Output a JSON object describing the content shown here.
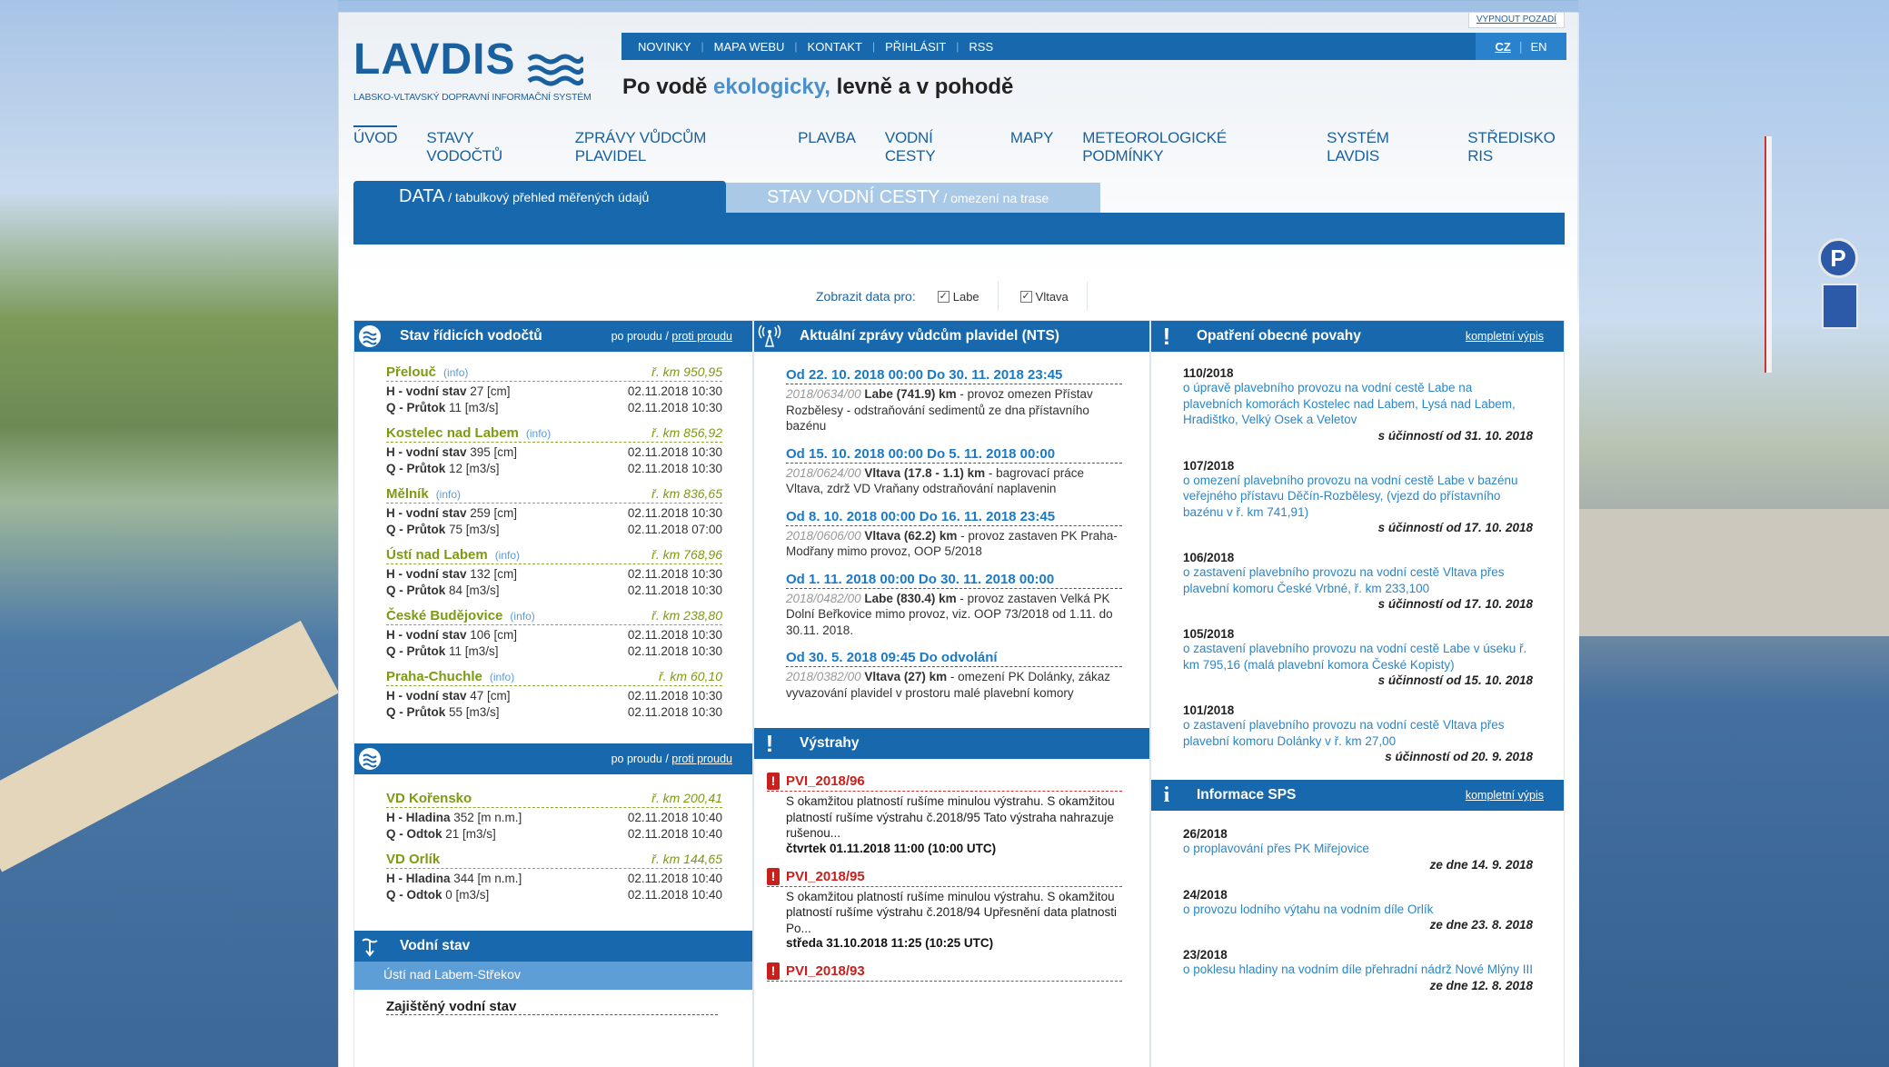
{
  "header": {
    "bg_toggle": "VYPNOUT POZADÍ",
    "logo_name": "LAVDIS",
    "logo_sub": "LABSKO-VLTAVSKÝ DOPRAVNÍ INFORMAČNÍ SYSTÉM",
    "topnav": [
      "NOVINKY",
      "MAPA WEBU",
      "KONTAKT",
      "PŘIHLÁSIT",
      "RSS"
    ],
    "lang_cz": "CZ",
    "lang_en": "EN",
    "slogan_a": "Po vodě ",
    "slogan_b": "ekologicky,",
    "slogan_c": " levně a v pohodě"
  },
  "mainnav": [
    "ÚVOD",
    "STAVY VODOČTŮ",
    "ZPRÁVY VŮDCŮM PLAVIDEL",
    "PLAVBA",
    "VODNÍ CESTY",
    "MAPY",
    "METEOROLOGICKÉ PODMÍNKY",
    "SYSTÉM LAVDIS",
    "STŘEDISKO RIS"
  ],
  "tabs": {
    "t1": "DATA",
    "t1_sub": " / tabulkový přehled měřených údajů",
    "t2": "STAV VODNÍ CESTY",
    "t2_sub": " / omezení na trase"
  },
  "filter": {
    "label": "Zobrazit data pro:",
    "opt1": "Labe",
    "opt2": "Vltava"
  },
  "col1": {
    "title": "Stav řídicích vodočtů",
    "dir_a": "po proudu / ",
    "dir_b": "proti proudu",
    "gauges": [
      {
        "name": "Přelouč",
        "info": "(info)",
        "km": "ř. km 950,95",
        "h_label": "H - vodní stav",
        "h_val": " 27 [cm]",
        "h_time": "02.11.2018 10:30",
        "q_label": "Q - Průtok",
        "q_val": " 11 [m3/s]",
        "q_time": "02.11.2018 10:30"
      },
      {
        "name": "Kostelec nad Labem",
        "info": "(info)",
        "km": "ř. km 856,92",
        "h_label": "H - vodní stav",
        "h_val": " 395 [cm]",
        "h_time": "02.11.2018 10:30",
        "q_label": "Q - Průtok",
        "q_val": " 12 [m3/s]",
        "q_time": "02.11.2018 10:30"
      },
      {
        "name": "Mělník",
        "info": "(info)",
        "km": "ř. km 836,65",
        "h_label": "H - vodní stav",
        "h_val": " 259 [cm]",
        "h_time": "02.11.2018 10:30",
        "q_label": "Q - Průtok",
        "q_val": " 75 [m3/s]",
        "q_time": "02.11.2018 07:00"
      },
      {
        "name": "Ústí nad Labem",
        "info": "(info)",
        "km": "ř. km 768,96",
        "h_label": "H - vodní stav",
        "h_val": " 132 [cm]",
        "h_time": "02.11.2018 10:30",
        "q_label": "Q - Průtok",
        "q_val": " 84 [m3/s]",
        "q_time": "02.11.2018 10:30"
      },
      {
        "name": "České Budějovice",
        "info": "(info)",
        "km": "ř. km 238,80",
        "h_label": "H - vodní stav",
        "h_val": " 106 [cm]",
        "h_time": "02.11.2018 10:30",
        "q_label": "Q - Průtok",
        "q_val": " 11 [m3/s]",
        "q_time": "02.11.2018 10:30"
      },
      {
        "name": "Praha-Chuchle",
        "info": "(info)",
        "km": "ř. km 60,10",
        "h_label": "H - vodní stav",
        "h_val": " 47 [cm]",
        "h_time": "02.11.2018 10:30",
        "q_label": "Q - Průtok",
        "q_val": " 55 [m3/s]",
        "q_time": "02.11.2018 10:30"
      }
    ],
    "dir2_a": "po proudu / ",
    "dir2_b": "proti proudu",
    "dams": [
      {
        "name": "VD Kořensko",
        "km": "ř. km 200,41",
        "h_label": "H - Hladina",
        "h_val": " 352 [m n.m.]",
        "h_time": "02.11.2018 10:40",
        "q_label": "Q - Odtok",
        "q_val": " 21 [m3/s]",
        "q_time": "02.11.2018 10:40"
      },
      {
        "name": "VD Orlík",
        "km": "ř. km 144,65",
        "h_label": "H - Hladina",
        "h_val": " 344 [m n.m.]",
        "h_time": "02.11.2018 10:40",
        "q_label": "Q - Odtok",
        "q_val": " 0 [m3/s]",
        "q_time": "02.11.2018 10:40"
      }
    ],
    "vodni_stav": "Vodní stav",
    "station": "Ústí nad Labem-Střekov",
    "zaj": "Zajištěný vodní stav"
  },
  "col2": {
    "title": "Aktuální zprávy vůdcům plavidel (NTS)",
    "items": [
      {
        "date": "Od 22. 10. 2018 00:00 Do 30. 11. 2018 23:45",
        "ref": "2018/0634/00",
        "loc": " Labe (741.9) km",
        "rest": " - provoz omezen Přístav Rozbělesy - odstraňování sedimentů ze dna přístavního bazénu"
      },
      {
        "date": "Od 15. 10. 2018 00:00 Do 5. 11. 2018 00:00",
        "ref": "2018/0624/00",
        "loc": " Vltava (17.8 - 1.1) km",
        "rest": " - bagrovací práce Vltava, zdrž VD Vraňany odstraňování naplavenin"
      },
      {
        "date": "Od 8. 10. 2018 00:00 Do 16. 11. 2018 23:45",
        "ref": "2018/0606/00",
        "loc": " Vltava (62.2) km",
        "rest": " - provoz zastaven PK Praha-Modřany mimo provoz, OOP 5/2018"
      },
      {
        "date": "Od 1. 11. 2018 00:00 Do 30. 11. 2018 00:00",
        "ref": "2018/0482/00",
        "loc": " Labe (830.4) km",
        "rest": " - provoz zastaven Velká PK Dolní Beřkovice mimo provoz, viz. OOP 73/2018 od 1.11. do 30.11. 2018."
      },
      {
        "date": "Od 30. 5. 2018 09:45 Do odvolání",
        "ref": "2018/0382/00",
        "loc": " Vltava (27) km",
        "rest": " - omezení PK Dolánky, zákaz vyvazování plavidel v prostoru malé plavební komory"
      }
    ],
    "warn_title": "Výstrahy",
    "warnings": [
      {
        "id": "PVI_2018/96",
        "text": "S okamžitou platností rušíme minulou výstrahu. S okamžitou platností rušíme výstrahu č.2018/95 Tato výstraha nahrazuje rušenou...",
        "date": "čtvrtek 01.11.2018 11:00 (10:00 UTC)"
      },
      {
        "id": "PVI_2018/95",
        "text": "S okamžitou platností rušíme minulou výstrahu. S okamžitou platností rušíme výstrahu č.2018/94 Upřesnění data platnosti Po...",
        "date": "středa 31.10.2018 11:25 (10:25 UTC)"
      },
      {
        "id": "PVI_2018/93",
        "text": "",
        "date": ""
      }
    ]
  },
  "col3": {
    "title": "Opatření obecné povahy",
    "link": "kompletní výpis",
    "items": [
      {
        "num": "110/2018",
        "text": "o úpravě plavebního provozu na vodní cestě Labe na plavebních komorách Kostelec nad Labem, Lysá nad Labem, Hradištko, Velký Osek a Veletov",
        "eff": "s účinností od 31. 10. 2018"
      },
      {
        "num": "107/2018",
        "text": "o omezení plavebního provozu na vodní cestě Labe v bazénu veřejného přístavu Děčín-Rozbělesy, (vjezd do přístavního bazénu v ř. km 741,91)",
        "eff": "s účinností od 17. 10. 2018"
      },
      {
        "num": "106/2018",
        "text": "o zastavení plavebního provozu na vodní cestě Vltava přes plavební komoru České Vrbné, ř. km 233,100",
        "eff": "s účinností od 17. 10. 2018"
      },
      {
        "num": "105/2018",
        "text": "o zastavení plavebního provozu na vodní cestě Labe v úseku ř. km 795,16 (malá plavební komora České Kopisty)",
        "eff": "s účinností od 15. 10. 2018"
      },
      {
        "num": "101/2018",
        "text": "o zastavení plavebního provozu na vodní cestě Vltava přes plavební komoru Dolánky v ř. km 27,00",
        "eff": "s účinností od 20. 9. 2018"
      }
    ],
    "sps_title": "Informace SPS",
    "sps_link": "kompletní výpis",
    "sps": [
      {
        "num": "26/2018",
        "text": "o proplavování přes PK Miřejovice",
        "date": "ze dne 14. 9. 2018"
      },
      {
        "num": "24/2018",
        "text": "o provozu lodního výtahu na vodním díle Orlík",
        "date": "ze dne 23. 8. 2018"
      },
      {
        "num": "23/2018",
        "text": "o poklesu hladiny na vodním díle přehradní nádrž Nové Mlýny III",
        "date": "ze dne 12. 8. 2018"
      }
    ]
  },
  "colors": {
    "primary": "#1768ad",
    "accent": "#7c9a12",
    "warning": "#c8201c",
    "link": "#2a86c9"
  }
}
